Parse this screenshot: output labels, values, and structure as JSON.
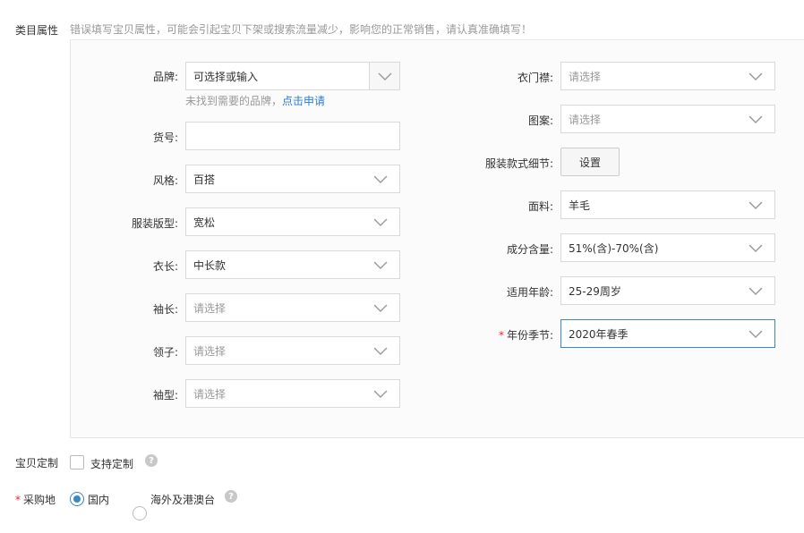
{
  "category_attrs": {
    "label": "类目属性",
    "warning": "错误填写宝贝属性，可能会引起宝贝下架或搜索流量减少，影响您的正常销售，请认真准确填写！"
  },
  "left_fields": {
    "brand": {
      "label": "品牌:",
      "placeholder": "可选择或输入",
      "hint": "未找到需要的品牌，",
      "hint_link": "点击申请"
    },
    "item_no": {
      "label": "货号:",
      "value": ""
    },
    "style": {
      "label": "风格:",
      "value": "百搭"
    },
    "fit": {
      "label": "服装版型:",
      "value": "宽松"
    },
    "length": {
      "label": "衣长:",
      "value": "中长款"
    },
    "sleeve_length": {
      "label": "袖长:",
      "placeholder": "请选择"
    },
    "collar": {
      "label": "领子:",
      "placeholder": "请选择"
    },
    "sleeve_type": {
      "label": "袖型:",
      "placeholder": "请选择"
    }
  },
  "right_fields": {
    "placket": {
      "label": "衣门襟:",
      "placeholder": "请选择"
    },
    "pattern": {
      "label": "图案:",
      "placeholder": "请选择"
    },
    "detail": {
      "label": "服装款式细节:",
      "button": "设置"
    },
    "fabric": {
      "label": "面料:",
      "value": "羊毛"
    },
    "composition": {
      "label": "成分含量:",
      "value": "51%(含)-70%(含)"
    },
    "age": {
      "label": "适用年龄:",
      "value": "25-29周岁"
    },
    "season": {
      "label": "年份季节:",
      "value": "2020年春季",
      "required_mark": "*"
    }
  },
  "customize": {
    "label": "宝贝定制",
    "option": "支持定制",
    "help": "?"
  },
  "purchase": {
    "label": "采购地",
    "required_mark": "*",
    "options": [
      "国内",
      "海外及港澳台"
    ],
    "selected": "国内",
    "help": "?"
  },
  "colors": {
    "accent": "#3a88c8",
    "link": "#2f7ccd",
    "required": "#f5222d"
  }
}
